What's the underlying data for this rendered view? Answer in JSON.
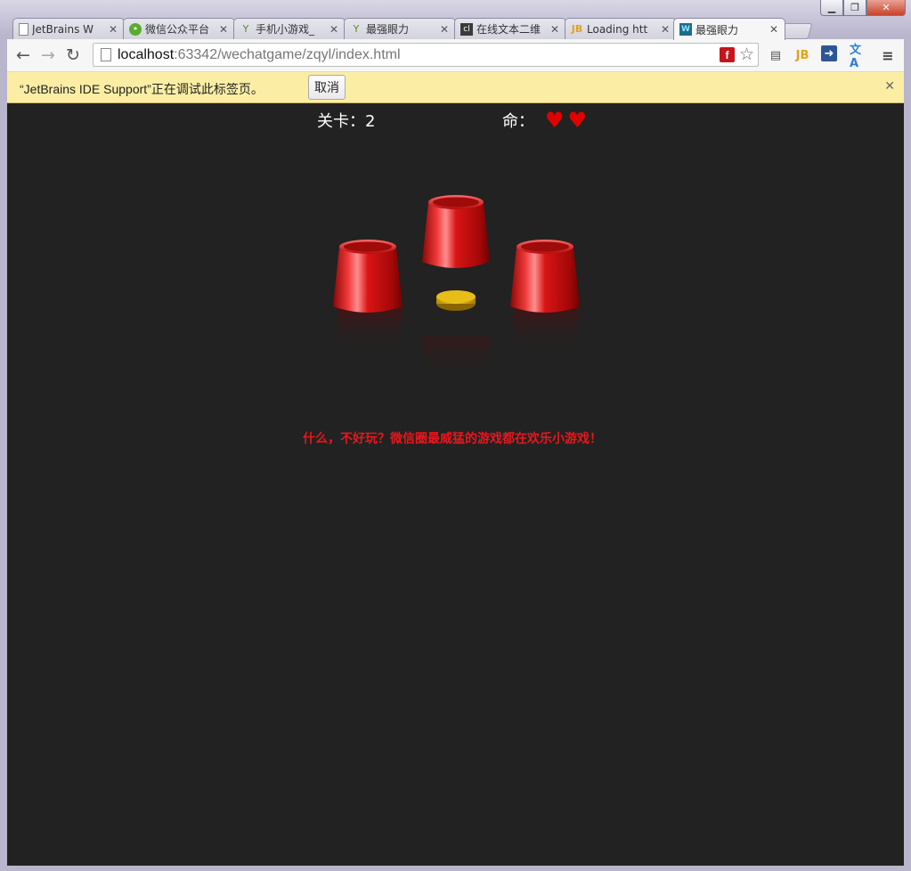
{
  "browser": {
    "tabs": [
      {
        "label": "JetBrains W",
        "icon": "page-icon"
      },
      {
        "label": "微信公众平台",
        "icon": "wechat-icon"
      },
      {
        "label": "手机小游戏_",
        "icon": "sprout-icon"
      },
      {
        "label": "最强眼力",
        "icon": "sprout-icon"
      },
      {
        "label": "在线文本二维",
        "icon": "cli-icon"
      },
      {
        "label": "Loading htt",
        "icon": "jb-icon"
      },
      {
        "label": "最强眼力",
        "icon": "ws-icon",
        "active": true
      }
    ],
    "url_host": "localhost",
    "url_path": ":63342/wechatgame/zqyl/index.html"
  },
  "infobar": {
    "message": "“JetBrains IDE Support”正在调试此标签页。",
    "cancel_label": "取消"
  },
  "game": {
    "level_label": "关卡：2",
    "lives_label": "命：",
    "lives": 2,
    "message": "什么，不好玩？微信圈最威猛的游戏都在欢乐小游戏！",
    "colors": {
      "cup": "#d81414",
      "coin": "#d9a400",
      "background": "#222222",
      "message": "#e8171c"
    }
  }
}
